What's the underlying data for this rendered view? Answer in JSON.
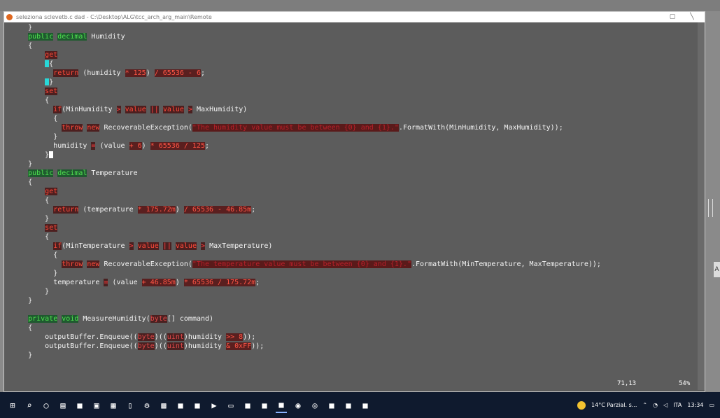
{
  "window": {
    "title": "seleziona sclevetb.c dad  -  C:\\Desktop\\ALG\\tcc_arch_arg_main\\Remote",
    "status_position": "71,13",
    "status_percent": "54%",
    "edge_tab": "A"
  },
  "code_lines": [
    [
      [
        "    }",
        "pl"
      ]
    ],
    [
      [
        "    ",
        "pl"
      ],
      [
        "public",
        "kw"
      ],
      [
        " ",
        "pl"
      ],
      [
        "decimal",
        "kw"
      ],
      [
        " Humidity",
        "id"
      ]
    ],
    [
      [
        "    {",
        "pl"
      ]
    ],
    [
      [
        "        ",
        "pl"
      ],
      [
        "get",
        "kwr"
      ]
    ],
    [
      [
        "        ",
        "pl"
      ],
      [
        "{",
        "cyan"
      ]
    ],
    [
      [
        "          ",
        "pl"
      ],
      [
        "return",
        "kwr"
      ],
      [
        " (humidity ",
        "id"
      ],
      [
        "* 125",
        "num"
      ],
      [
        ") ",
        "id"
      ],
      [
        "/ 65536 - 6",
        "num"
      ],
      [
        ";",
        "pl"
      ]
    ],
    [
      [
        "        ",
        "pl"
      ],
      [
        "}",
        "cyan"
      ]
    ],
    [
      [
        "        ",
        "pl"
      ],
      [
        "set",
        "kwr"
      ]
    ],
    [
      [
        "        {",
        "pl"
      ]
    ],
    [
      [
        "          ",
        "pl"
      ],
      [
        "if",
        "kwr"
      ],
      [
        "(MinHumidity ",
        "id"
      ],
      [
        ">",
        "op"
      ],
      [
        " ",
        "pl"
      ],
      [
        "value",
        "kwr"
      ],
      [
        " ",
        "pl"
      ],
      [
        "||",
        "op"
      ],
      [
        " ",
        "pl"
      ],
      [
        "value",
        "kwr"
      ],
      [
        " ",
        "pl"
      ],
      [
        ">",
        "op"
      ],
      [
        " MaxHumidity)",
        "id"
      ]
    ],
    [
      [
        "          {",
        "pl"
      ]
    ],
    [
      [
        "            ",
        "pl"
      ],
      [
        "throw",
        "kwr"
      ],
      [
        " ",
        "pl"
      ],
      [
        "new",
        "kwr"
      ],
      [
        " RecoverableException(",
        "id"
      ],
      [
        "\"The humidity value must be between {0} and {1}.\"",
        "str"
      ],
      [
        ".FormatWith(MinHumidity, MaxHumidity));",
        "id"
      ]
    ],
    [
      [
        "          }",
        "pl"
      ]
    ],
    [
      [
        "          humidity ",
        "id"
      ],
      [
        "=",
        "op"
      ],
      [
        " (value ",
        "id"
      ],
      [
        "+ 6",
        "num"
      ],
      [
        ") ",
        "id"
      ],
      [
        "* 65536 / 125",
        "num"
      ],
      [
        ";",
        "pl"
      ]
    ],
    [
      [
        "        }",
        "pl"
      ],
      [
        "CURSOR",
        "cursor"
      ]
    ],
    [
      [
        "    }",
        "pl"
      ]
    ],
    [
      [
        "    ",
        "pl"
      ],
      [
        "public",
        "kw"
      ],
      [
        " ",
        "pl"
      ],
      [
        "decimal",
        "kw"
      ],
      [
        " Temperature",
        "id"
      ]
    ],
    [
      [
        "    {",
        "pl"
      ]
    ],
    [
      [
        "        ",
        "pl"
      ],
      [
        "get",
        "kwr"
      ]
    ],
    [
      [
        "        {",
        "pl"
      ]
    ],
    [
      [
        "          ",
        "pl"
      ],
      [
        "return",
        "kwr"
      ],
      [
        " (temperature ",
        "id"
      ],
      [
        "* 175.72m",
        "num"
      ],
      [
        ") ",
        "id"
      ],
      [
        "/ 65536 - 46.85m",
        "num"
      ],
      [
        ";",
        "pl"
      ]
    ],
    [
      [
        "        }",
        "pl"
      ]
    ],
    [
      [
        "        ",
        "pl"
      ],
      [
        "set",
        "kwr"
      ]
    ],
    [
      [
        "        {",
        "pl"
      ]
    ],
    [
      [
        "          ",
        "pl"
      ],
      [
        "if",
        "kwr"
      ],
      [
        "(MinTemperature ",
        "id"
      ],
      [
        ">",
        "op"
      ],
      [
        " ",
        "pl"
      ],
      [
        "value",
        "kwr"
      ],
      [
        " ",
        "pl"
      ],
      [
        "||",
        "op"
      ],
      [
        " ",
        "pl"
      ],
      [
        "value",
        "kwr"
      ],
      [
        " ",
        "pl"
      ],
      [
        ">",
        "op"
      ],
      [
        " MaxTemperature)",
        "id"
      ]
    ],
    [
      [
        "          {",
        "pl"
      ]
    ],
    [
      [
        "            ",
        "pl"
      ],
      [
        "throw",
        "kwr"
      ],
      [
        " ",
        "pl"
      ],
      [
        "new",
        "kwr"
      ],
      [
        " RecoverableException(",
        "id"
      ],
      [
        "\"The temperature value must be between {0} and {1}.\"",
        "str"
      ],
      [
        ".FormatWith(MinTemperature, MaxTemperature));",
        "id"
      ]
    ],
    [
      [
        "          }",
        "pl"
      ]
    ],
    [
      [
        "          temperature ",
        "id"
      ],
      [
        "=",
        "op"
      ],
      [
        " (value ",
        "id"
      ],
      [
        "+ 46.85m",
        "num"
      ],
      [
        ") ",
        "id"
      ],
      [
        "* 65536 / 175.72m",
        "num"
      ],
      [
        ";",
        "pl"
      ]
    ],
    [
      [
        "        }",
        "pl"
      ]
    ],
    [
      [
        "    }",
        "pl"
      ]
    ],
    [
      [
        "",
        "pl"
      ]
    ],
    [
      [
        "    ",
        "pl"
      ],
      [
        "private",
        "kw"
      ],
      [
        " ",
        "pl"
      ],
      [
        "void",
        "kw"
      ],
      [
        " MeasureHumidity(",
        "id"
      ],
      [
        "byte",
        "typ"
      ],
      [
        "[] command)",
        "id"
      ]
    ],
    [
      [
        "    {",
        "pl"
      ]
    ],
    [
      [
        "        outputBuffer.Enqueue((",
        "id"
      ],
      [
        "byte",
        "typ"
      ],
      [
        ")((",
        "id"
      ],
      [
        "uint",
        "typ"
      ],
      [
        ")humidity ",
        "id"
      ],
      [
        ">> 8",
        "num"
      ],
      [
        "));",
        "id"
      ]
    ],
    [
      [
        "        outputBuffer.Enqueue((",
        "id"
      ],
      [
        "byte",
        "typ"
      ],
      [
        ")((",
        "id"
      ],
      [
        "uint",
        "typ"
      ],
      [
        ")humidity ",
        "id"
      ],
      [
        "& 0xFF",
        "num"
      ],
      [
        "));",
        "id"
      ]
    ],
    [
      [
        "    }",
        "pl"
      ]
    ]
  ],
  "taskbar": {
    "weather": "14°C  Parzial. s...",
    "language": "ITA",
    "time": "13:34"
  },
  "taskbar_icons": [
    "windows-start-icon",
    "search-icon",
    "cortana-icon",
    "task-view-icon",
    "app-icon",
    "file-explorer-icon",
    "notepad-icon",
    "document-icon",
    "settings-icon",
    "calculator-icon",
    "app-icon",
    "app-icon",
    "media-icon",
    "terminal-icon",
    "app-icon",
    "app-icon",
    "app-icon",
    "pdf-icon",
    "chrome-icon",
    "app-icon",
    "app-icon",
    "app-icon"
  ]
}
